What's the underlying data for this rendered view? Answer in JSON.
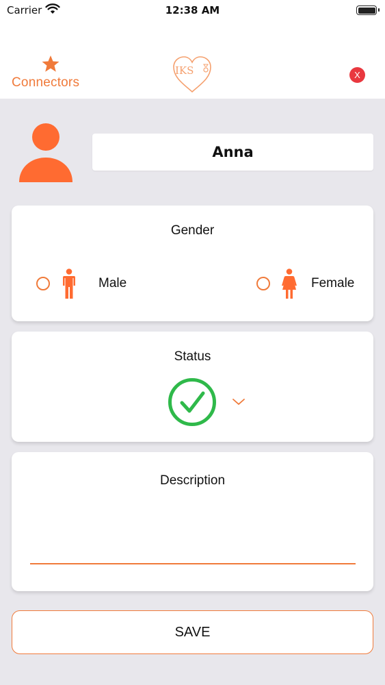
{
  "status_bar": {
    "carrier": "Carrier",
    "time": "12:38 AM"
  },
  "nav": {
    "connectors_label": "Connectors",
    "logo_text": "IKS",
    "close_label": "X"
  },
  "profile": {
    "name": "Anna"
  },
  "gender": {
    "title": "Gender",
    "options": [
      {
        "label": "Male",
        "selected": false
      },
      {
        "label": "Female",
        "selected": false
      }
    ]
  },
  "status": {
    "title": "Status",
    "icon": "check-circle-icon"
  },
  "description": {
    "title": "Description",
    "value": ""
  },
  "save_label": "SAVE",
  "colors": {
    "accent": "#f07a3a",
    "status_green": "#2fb94a",
    "close_red": "#e9383f",
    "background": "#e8e7ec"
  }
}
